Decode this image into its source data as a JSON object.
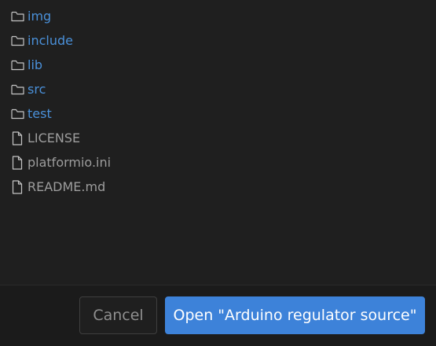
{
  "entries": [
    {
      "name": "img",
      "kind": "folder",
      "icon": "folder-icon"
    },
    {
      "name": "include",
      "kind": "folder",
      "icon": "folder-icon"
    },
    {
      "name": "lib",
      "kind": "folder",
      "icon": "folder-icon"
    },
    {
      "name": "src",
      "kind": "folder",
      "icon": "folder-icon"
    },
    {
      "name": "test",
      "kind": "folder",
      "icon": "folder-icon"
    },
    {
      "name": "LICENSE",
      "kind": "file",
      "icon": "file-icon"
    },
    {
      "name": "platformio.ini",
      "kind": "file",
      "icon": "file-icon"
    },
    {
      "name": "README.md",
      "kind": "file",
      "icon": "file-icon"
    }
  ],
  "footer": {
    "cancel_label": "Cancel",
    "open_label": "Open \"Arduino regulator source\""
  },
  "colors": {
    "background": "#1f1f1f",
    "folder_text": "#4a90d9",
    "file_text": "#9d9d9d",
    "primary_button": "#3d82d9"
  }
}
